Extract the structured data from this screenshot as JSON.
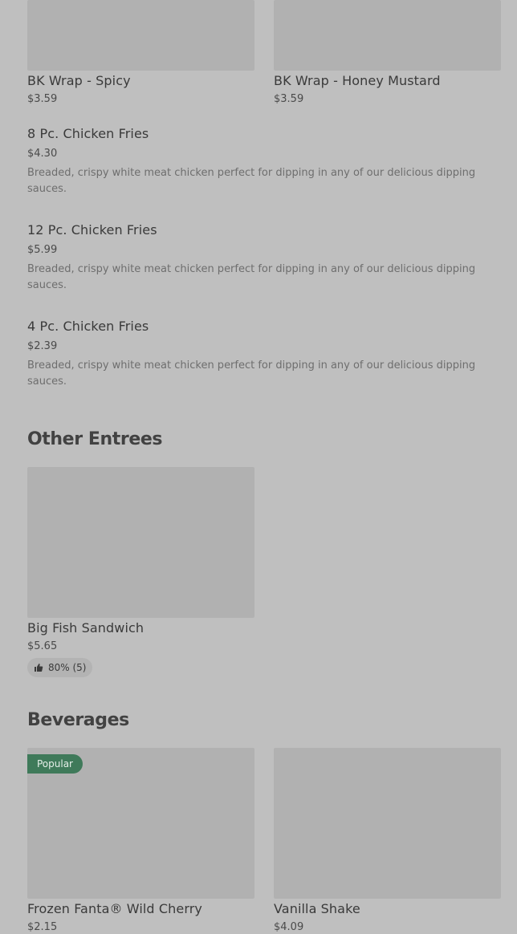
{
  "top_items": [
    {
      "name": "BK Wrap - Spicy",
      "price": "$3.59"
    },
    {
      "name": "BK Wrap - Honey Mustard",
      "price": "$3.59"
    }
  ],
  "list_items": [
    {
      "name": "8 Pc. Chicken Fries",
      "price": "$4.30",
      "description": "Breaded, crispy white meat chicken perfect for dipping in any of our delicious dipping sauces."
    },
    {
      "name": "12 Pc. Chicken Fries",
      "price": "$5.99",
      "description": "Breaded, crispy white meat chicken perfect for dipping in any of our delicious dipping sauces."
    },
    {
      "name": "4 Pc. Chicken Fries",
      "price": "$2.39",
      "description": "Breaded, crispy white meat chicken perfect for dipping in any of our delicious dipping sauces."
    }
  ],
  "other_entrees": {
    "title": "Other Entrees",
    "items": [
      {
        "name": "Big Fish Sandwich",
        "price": "$5.65",
        "rating": "80% (5)",
        "rating_icon": "thumbs-up-icon"
      }
    ]
  },
  "beverages": {
    "title": "Beverages",
    "items": [
      {
        "name": "Frozen Fanta® Wild Cherry",
        "price": "$2.15",
        "badge": "Popular"
      },
      {
        "name": "Vanilla Shake",
        "price": "$4.09"
      }
    ]
  },
  "colors": {
    "background": "#bfbfbf",
    "image_placeholder": "#b1b1b1",
    "badge_green": "#3f7a5a"
  }
}
